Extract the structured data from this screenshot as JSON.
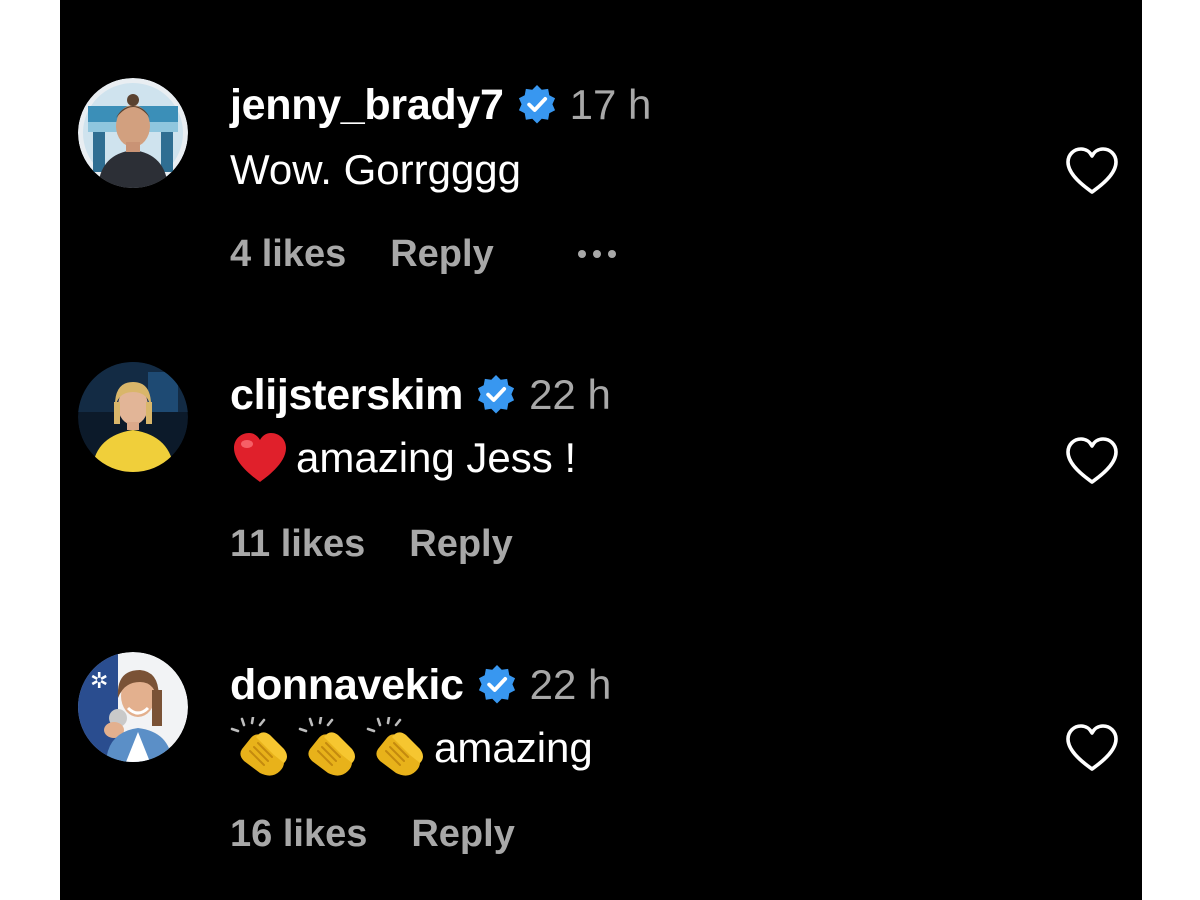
{
  "colors": {
    "background": "#000000",
    "username": "#ffffff",
    "secondary_text": "#a8a8a8",
    "verified_badge": "#3897f0"
  },
  "comments": [
    {
      "username": "jenny_brady7",
      "verified": true,
      "time": "17 h",
      "text": "Wow. Gorrgggg",
      "likes": "4 likes",
      "reply_label": "Reply",
      "has_more_menu": true,
      "like_icon": "heart-outline-icon"
    },
    {
      "username": "clijsterskim",
      "verified": true,
      "time": "22 h",
      "emoji": "red-heart-emoji",
      "text": "amazing Jess !",
      "likes": "11 likes",
      "reply_label": "Reply",
      "like_icon": "heart-outline-icon"
    },
    {
      "username": "donnavekic",
      "verified": true,
      "time": "22 h",
      "emoji": "clapping-hands-emoji",
      "emoji_count": 3,
      "text": "amazing",
      "likes": "16 likes",
      "reply_label": "Reply",
      "like_icon": "heart-outline-icon"
    }
  ]
}
